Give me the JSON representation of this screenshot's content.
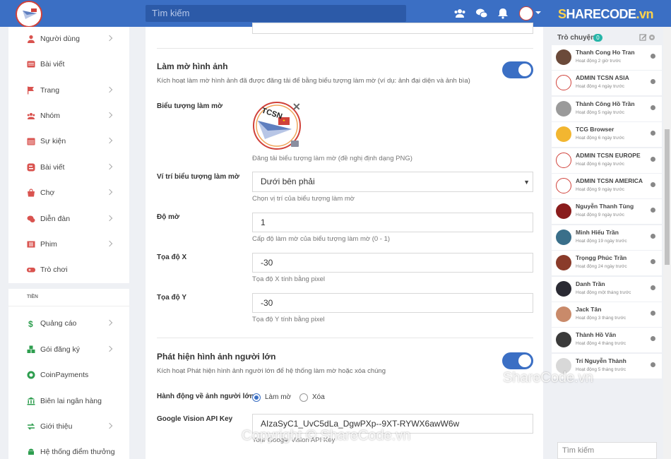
{
  "header": {
    "search_placeholder": "Tìm kiếm",
    "brand": {
      "prefix": "S",
      "main": "HARECODE",
      "suffix": ".vn"
    },
    "icons": [
      "users-icon",
      "chat-icon",
      "bell-icon"
    ]
  },
  "sidebar": {
    "items": [
      {
        "label": "Người dùng",
        "icon": "user-icon",
        "has_chevron": true
      },
      {
        "label": "Bài viết",
        "icon": "post-icon",
        "has_chevron": false
      },
      {
        "label": "Trang",
        "icon": "flag-icon",
        "has_chevron": true
      },
      {
        "label": "Nhóm",
        "icon": "group-icon",
        "has_chevron": true
      },
      {
        "label": "Sự kiện",
        "icon": "calendar-icon",
        "has_chevron": true
      },
      {
        "label": "Bài viết",
        "icon": "blog-icon",
        "has_chevron": true
      },
      {
        "label": "Chợ",
        "icon": "bag-icon",
        "has_chevron": true
      },
      {
        "label": "Diễn đàn",
        "icon": "forum-icon",
        "has_chevron": true
      },
      {
        "label": "Phim",
        "icon": "film-icon",
        "has_chevron": true
      },
      {
        "label": "Trò chơi",
        "icon": "gamepad-icon",
        "has_chevron": false
      }
    ],
    "money_heading": "TIỀN",
    "money_items": [
      {
        "label": "Quảng cáo",
        "icon": "dollar-icon",
        "has_chevron": true
      },
      {
        "label": "Gói đăng ký",
        "icon": "cubes-icon",
        "has_chevron": true
      },
      {
        "label": "CoinPayments",
        "icon": "coin-icon",
        "has_chevron": false
      },
      {
        "label": "Biên lai ngân hàng",
        "icon": "bank-icon",
        "has_chevron": false
      },
      {
        "label": "Giới thiệu",
        "icon": "exchange-icon",
        "has_chevron": true
      },
      {
        "label": "Hệ thống điểm thưởng",
        "icon": "android-icon",
        "has_chevron": false
      }
    ]
  },
  "main": {
    "blur_section": {
      "title": "Làm mờ hình ảnh",
      "description": "Kích hoạt làm mờ hình ảnh đã được đăng tải để bằng biểu tượng làm mờ (ví dụ: ảnh đại diện và ảnh bìa)",
      "enabled": true
    },
    "blur_icon": {
      "label": "Biểu tượng làm mờ",
      "logo_text": "TCSN",
      "help": "Đăng tải biểu tượng làm mờ (đề nghị định dạng PNG)"
    },
    "blur_position": {
      "label": "Ví trí biểu tượng làm mờ",
      "value": "Dưới bên phải",
      "help": "Chọn vị trí của biểu tượng làm mờ"
    },
    "blur_level": {
      "label": "Độ mờ",
      "value": "1",
      "help": "Cấp độ làm mờ của biểu tượng làm mờ (0 - 1)"
    },
    "coord_x": {
      "label": "Tọa độ X",
      "value": "-30",
      "help": "Tọa độ X tính bằng pixel"
    },
    "coord_y": {
      "label": "Tọa độ Y",
      "value": "-30",
      "help": "Tọa độ Y tính bằng pixel"
    },
    "adult_section": {
      "title": "Phát hiện hình ảnh người lớn",
      "description": "Kích hoạt Phát hiện hình ảnh người lớn để hệ thống làm mờ hoặc xóa chúng",
      "enabled": true
    },
    "adult_action": {
      "label": "Hành động về ảnh người lớn",
      "options": [
        "Làm mờ",
        "Xóa"
      ],
      "selected": "Làm mờ"
    },
    "vision_key": {
      "label": "Google Vision API Key",
      "value": "AIzaSyC1_UvC5dLa_DgwPXp--9XT-RYWX6awW6w",
      "help": "Your Google Vision API Key"
    }
  },
  "chat": {
    "title": "Trò chuyện",
    "count": "0",
    "search_placeholder": "Tìm kiếm",
    "users": [
      {
        "name": "Thanh Cong Ho Tran",
        "status": "Hoạt động 2 giờ trước",
        "avatar_color": "#6b4a3a"
      },
      {
        "name": "ADMIN TCSN ASIA",
        "status": "Hoạt động 4 ngày trước",
        "avatar_color": "#ffffff"
      },
      {
        "name": "Thành Công Hồ Trần",
        "status": "Hoạt động 5 ngày trước",
        "avatar_color": "#9a9a9a"
      },
      {
        "name": "TCG Browser",
        "status": "Hoạt động 6 ngày trước",
        "avatar_color": "#f2b630"
      },
      {
        "name": "ADMIN TCSN EUROPE",
        "status": "Hoạt động 6 ngày trước",
        "avatar_color": "#ffffff"
      },
      {
        "name": "ADMIN TCSN AMERICA",
        "status": "Hoạt động 9 ngày trước",
        "avatar_color": "#ffffff"
      },
      {
        "name": "Nguyễn Thanh Tùng",
        "status": "Hoạt động 9 ngày trước",
        "avatar_color": "#8a1c1c"
      },
      {
        "name": "Minh Hiếu Trần",
        "status": "Hoạt động 19 ngày trước",
        "avatar_color": "#3a6f8a"
      },
      {
        "name": "Trọngg Phúc Trần",
        "status": "Hoạt động 24 ngày trước",
        "avatar_color": "#8a3b2a"
      },
      {
        "name": "Danh Trần",
        "status": "Hoạt động một tháng trước",
        "avatar_color": "#2a2a33"
      },
      {
        "name": "Jack Tân",
        "status": "Hoạt động 3 tháng trước",
        "avatar_color": "#c98a6a"
      },
      {
        "name": "Thành Hồ Văn",
        "status": "Hoạt động 4 tháng trước",
        "avatar_color": "#3a3a3a"
      },
      {
        "name": "Trí Nguyễn Thành",
        "status": "Hoạt động 5 tháng trước",
        "avatar_color": "#d8d8d8"
      }
    ]
  },
  "watermarks": {
    "mid": "ShareCode.vn",
    "bottom": "Copyright © ShareCode.vn"
  }
}
